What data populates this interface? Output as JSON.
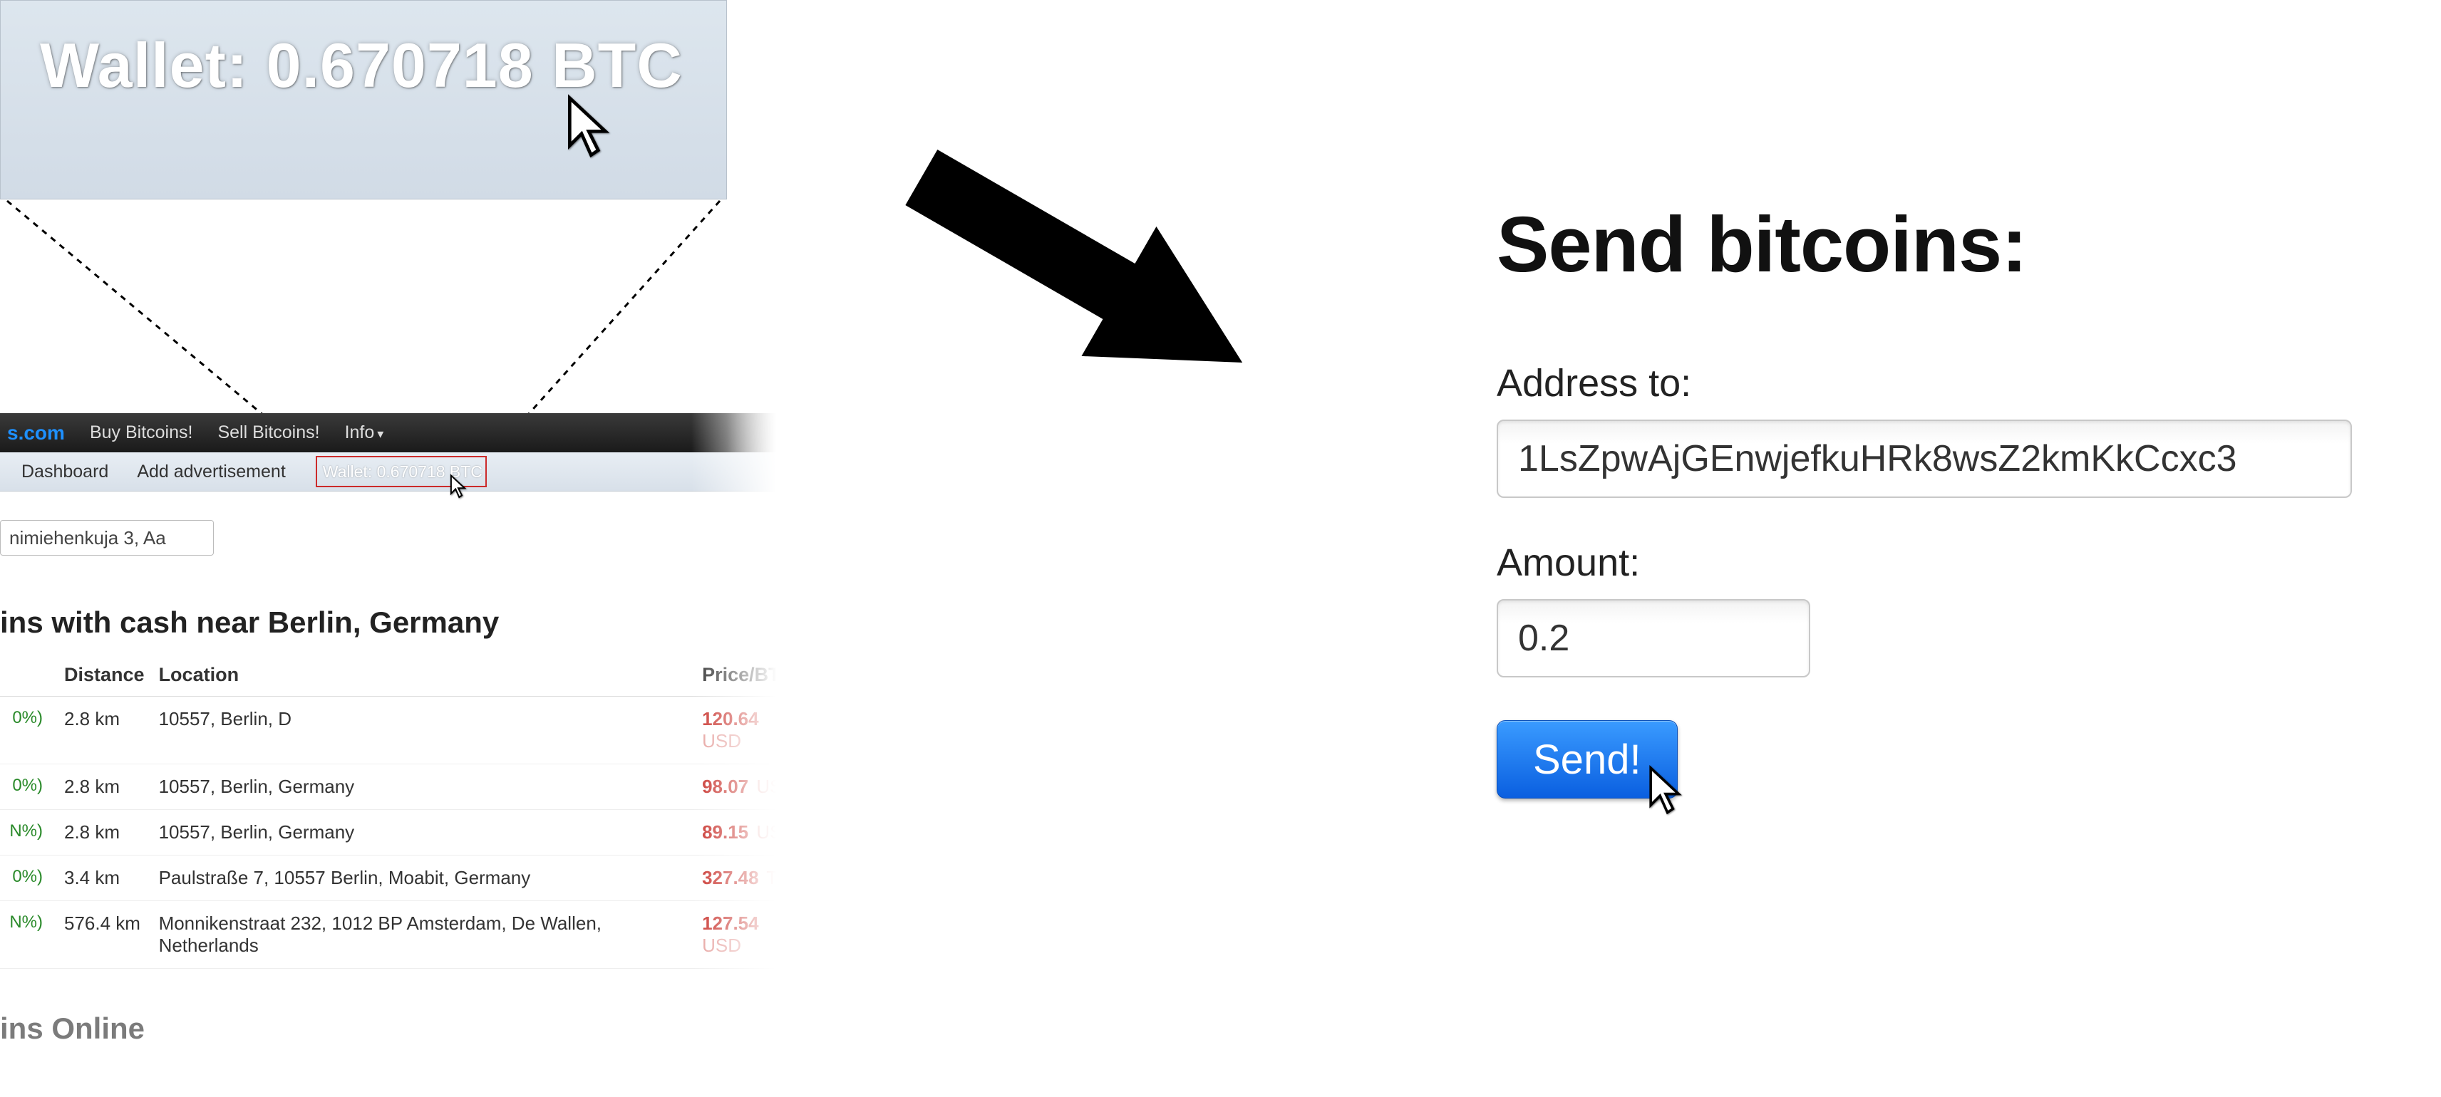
{
  "zoom": {
    "wallet_text": "Wallet: 0.670718 BTC"
  },
  "mini": {
    "brand_suffix": "s.com",
    "nav": {
      "buy": "Buy Bitcoins!",
      "sell": "Sell Bitcoins!",
      "info": "Info"
    },
    "subnav": {
      "dashboard": "Dashboard",
      "add_ad": "Add advertisement",
      "wallet": "Wallet: 0.670718 BTC"
    },
    "search_value": "nimiehenkuja 3, Aa",
    "heading": "ins with cash near Berlin, Germany",
    "columns": {
      "distance": "Distance",
      "location": "Location",
      "price": "Price/BTC"
    },
    "rows": [
      {
        "pct": "0%)",
        "dist": "2.8 km",
        "loc": "10557, Berlin, D",
        "price": "120.64",
        "cur": "USD"
      },
      {
        "pct": "0%)",
        "dist": "2.8 km",
        "loc": "10557, Berlin, Germany",
        "price": "98.07",
        "cur": "USD"
      },
      {
        "pct": "N%)",
        "dist": "2.8 km",
        "loc": "10557, Berlin, Germany",
        "price": "89.15",
        "cur": "USD"
      },
      {
        "pct": "0%)",
        "dist": "3.4 km",
        "loc": "Paulstraße 7, 10557 Berlin, Moabit, Germany",
        "price": "327.48",
        "cur": "TMT"
      },
      {
        "pct": "N%)",
        "dist": "576.4 km",
        "loc": "Monnikenstraat 232, 1012 BP Amsterdam, De Wallen, Netherlands",
        "price": "127.54",
        "cur": "USD"
      }
    ],
    "heading2": "ins Online"
  },
  "form": {
    "title": "Send bitcoins:",
    "address_label": "Address to:",
    "address_value": "1LsZpwAjGEnwjefkuHRk8wsZ2kmKkCcxc3",
    "amount_label": "Amount:",
    "amount_value": "0.2",
    "send_label": "Send!"
  }
}
